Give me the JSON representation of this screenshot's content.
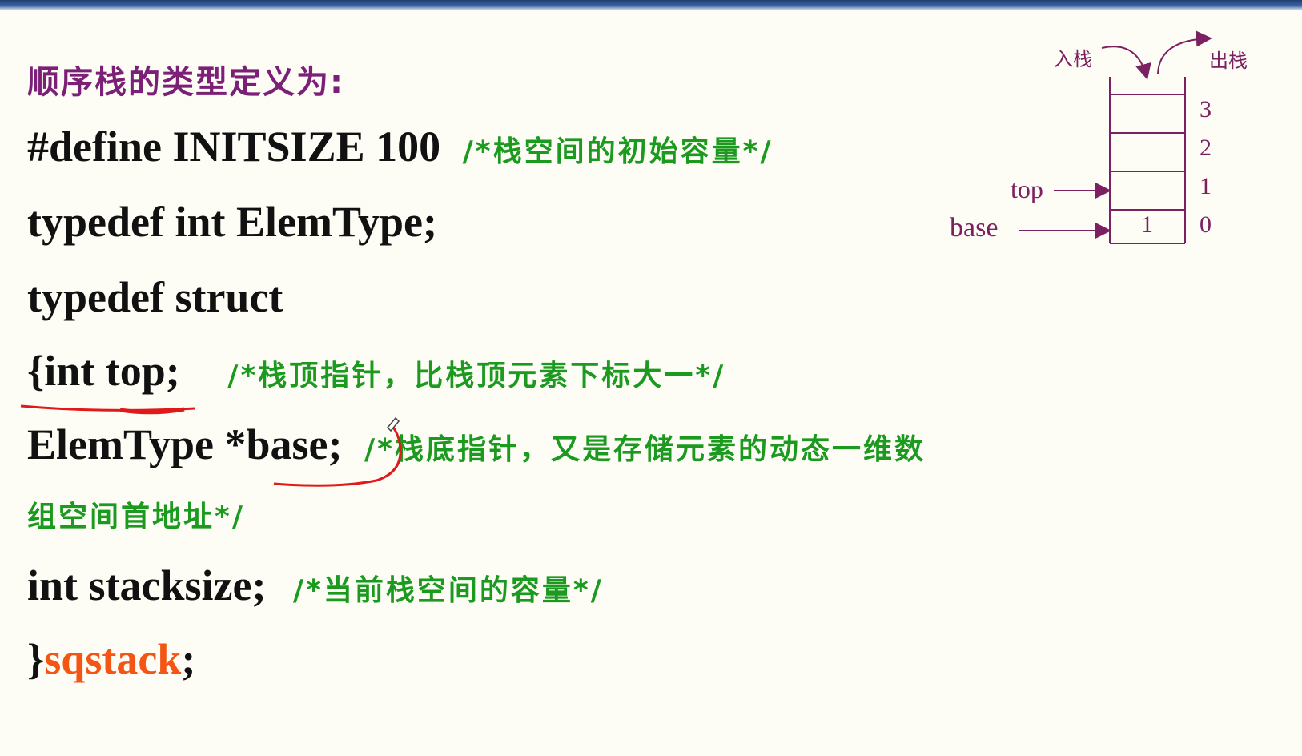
{
  "heading": "顺序栈的类型定义为:",
  "lines": [
    {
      "code": "#define INITSIZE 100",
      "comment": "/*栈空间的初始容量*/"
    },
    {
      "code": "typedef int ElemType;"
    },
    {
      "code": "typedef struct"
    },
    {
      "code": "{int top;",
      "comment": "/*栈顶指针，比栈顶元素下标大一*/"
    },
    {
      "code": "ElemType *base;",
      "comment": "/*栈底指针，又是存储元素的动态一维数"
    },
    {
      "comment": "组空间首地址*/"
    },
    {
      "code": "int stacksize;",
      "comment": "/*当前栈空间的容量*/"
    },
    {
      "code": "}",
      "ident": "sqstack",
      "tail": ";"
    }
  ],
  "diagram": {
    "push_label": "入栈",
    "pop_label": "出栈",
    "top_label": "top",
    "base_label": "base",
    "indices": [
      "3",
      "2",
      "1",
      "0"
    ],
    "cell_values": [
      "",
      "",
      "",
      "1"
    ]
  },
  "colors": {
    "heading": "#7b1f77",
    "code": "#111111",
    "comment": "#1c9a1f",
    "identifier": "#f25514",
    "diagram": "#7b2060",
    "annotation": "#e01a1a"
  }
}
